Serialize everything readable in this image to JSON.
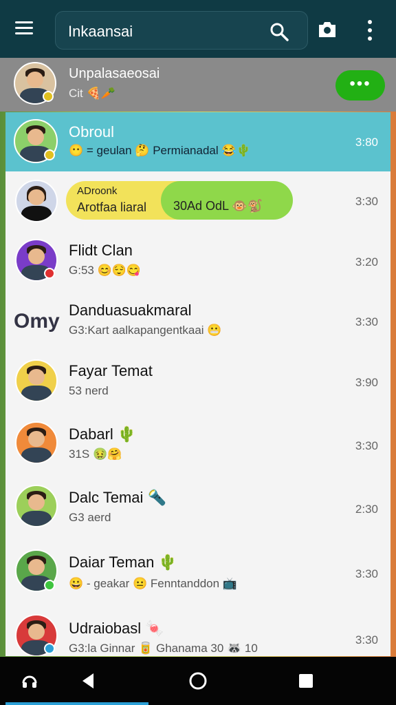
{
  "header": {
    "search_value": "Inkaansai",
    "icons": [
      "menu-icon",
      "search-icon",
      "camera-icon",
      "more-icon"
    ]
  },
  "pinned": {
    "name": "Unpalasaeosai",
    "preview": "Cit 🍕🥕",
    "action_label": "•••",
    "action_color": "#22b014"
  },
  "chats": [
    {
      "name": "Obroul",
      "preview": "😶 = geulan 🤔 Permianadal 😂🌵",
      "time": "3:80",
      "active": true
    },
    {
      "name": "",
      "preview": "",
      "time": "3:30",
      "bubble": {
        "line1": "ADroonk",
        "line2": "Arotfaa liaral",
        "green_text": "30Ad OdL 🐵🐒"
      }
    },
    {
      "name": "Flidt Clan",
      "preview": "G:53 😊😌😋",
      "time": "3:20"
    },
    {
      "name": "Danduasuakmaral",
      "preview": "G3:Kart aalkapangentkaai 😬",
      "time": "3:30",
      "logo_text": "Omy"
    },
    {
      "name": "Fayar Temat",
      "preview": "53 nerd",
      "time": "3:90"
    },
    {
      "name": "Dabarl 🌵",
      "preview": "31S 🤢🤗",
      "time": "3:30"
    },
    {
      "name": "Dalc Temai 🔦",
      "preview": "G3 aerd",
      "time": "2:30"
    },
    {
      "name": "Daiar Teman 🌵",
      "preview": "😀 - geakar 😐 Fenntanddon 📺",
      "time": "3:30"
    },
    {
      "name": "Udraiobasl 🍬",
      "preview": "G3:la Ginnar 🥫 Ghanama 30 🦝 10",
      "time": "3:30"
    }
  ],
  "colors": {
    "topbar": "#0f3a44",
    "active_row": "#5bc2ce",
    "accent_green": "#22b014",
    "navbar": "#050505"
  }
}
